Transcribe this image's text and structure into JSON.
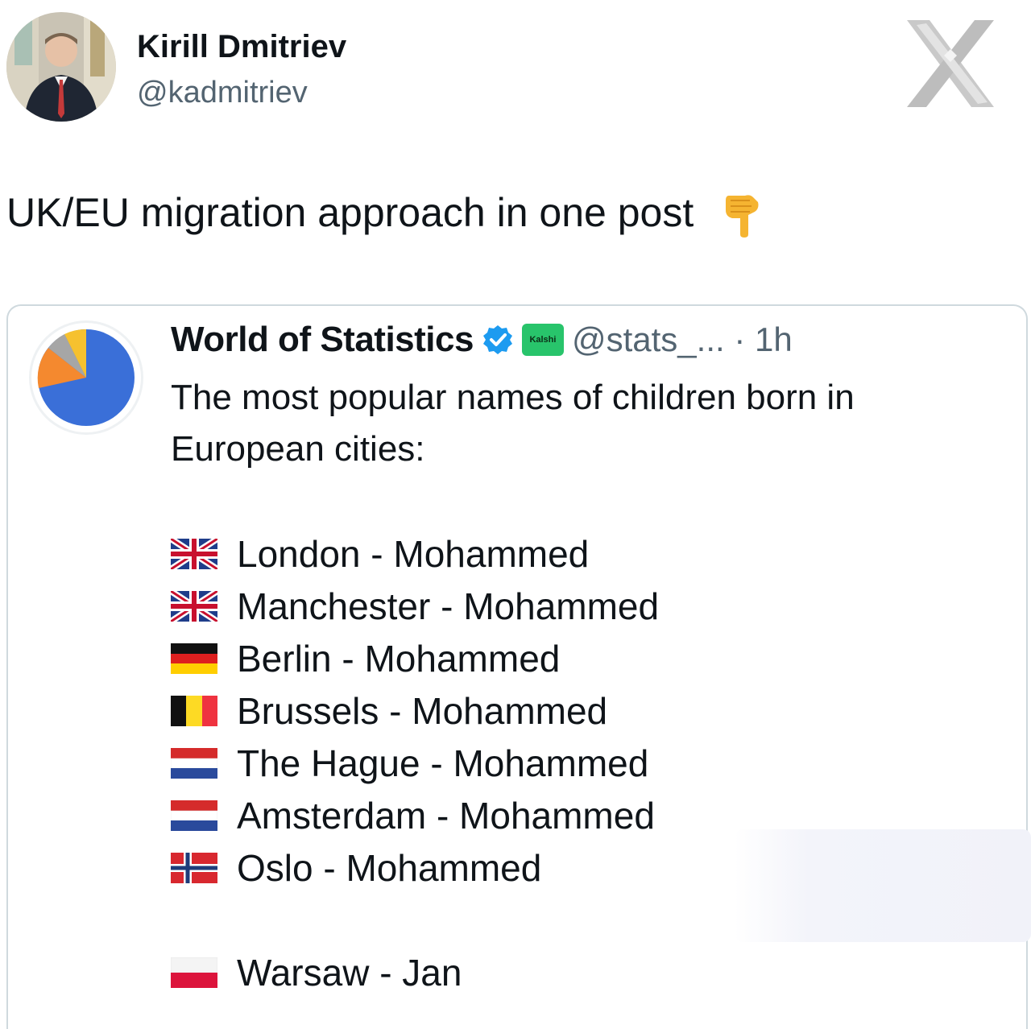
{
  "author": {
    "name": "Kirill Dmitriev",
    "handle": "@kadmitriev",
    "avatar_icon": "person-photo"
  },
  "platform_logo_icon": "x-logo-icon",
  "tweet_text": "UK/EU migration approach in one post",
  "tweet_emoji": "backhand-index-pointing-down",
  "quoted": {
    "name": "World of Statistics",
    "verified_icon": "verified-badge-icon",
    "badge_label": "Kalshi",
    "handle_time": "@stats_... · 1h",
    "text": "The most popular names of children born in European cities:",
    "cities": [
      {
        "flag": "uk",
        "text": "London - Mohammed"
      },
      {
        "flag": "uk",
        "text": "Manchester - Mohammed"
      },
      {
        "flag": "de",
        "text": "Berlin - Mohammed"
      },
      {
        "flag": "be",
        "text": "Brussels - Mohammed"
      },
      {
        "flag": "nl",
        "text": "The Hague - Mohammed"
      },
      {
        "flag": "nl",
        "text": "Amsterdam - Mohammed"
      },
      {
        "flag": "no",
        "text": "Oslo - Mohammed"
      },
      {
        "flag": "pl",
        "text": "Warsaw - Jan"
      }
    ]
  },
  "colors": {
    "verified": "#1d9bf0",
    "kalshi": "#28c46b",
    "pie_blue": "#3a6fd8",
    "pie_orange": "#f4892f",
    "pie_gray": "#a6a6a6",
    "pie_yellow": "#f6c12f"
  }
}
